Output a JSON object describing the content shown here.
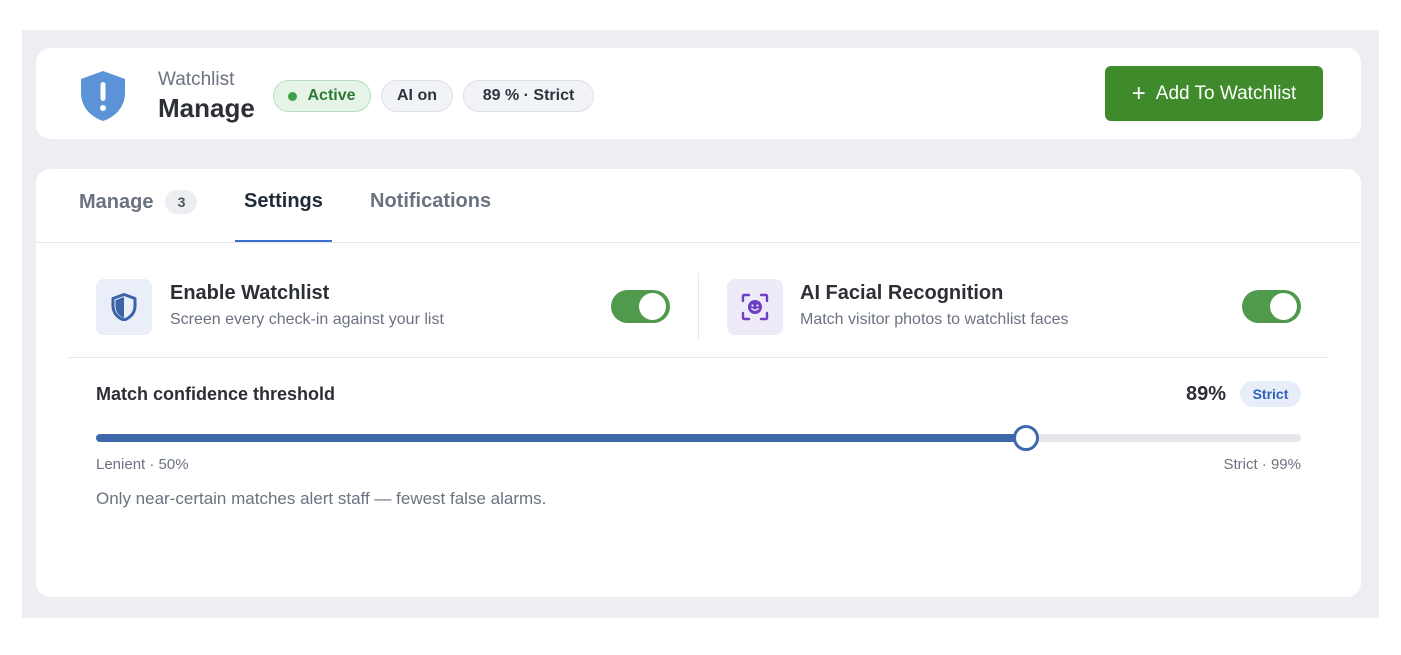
{
  "header": {
    "subtitle": "Watchlist",
    "title": "Manage",
    "status_badge": "Active",
    "ai_badge": "AI on",
    "threshold_badge_value": "89",
    "threshold_badge_suffix": " % · Strict",
    "add_button_label": "Add To Watchlist",
    "brand_color": "#3f8a2a"
  },
  "tabs": [
    {
      "label": "Manage",
      "count": "3",
      "selected": false
    },
    {
      "label": "Settings",
      "selected": true
    },
    {
      "label": "Notifications",
      "selected": false
    }
  ],
  "settings": {
    "features": [
      {
        "title": "Enable Watchlist",
        "description": "Screen every check-in against your list",
        "icon": "shield-icon",
        "enabled": true
      },
      {
        "title": "AI Facial Recognition",
        "description": "Match visitor photos to watchlist faces",
        "icon": "face-scan-icon",
        "enabled": true
      }
    ],
    "threshold": {
      "label": "Match confidence threshold",
      "value_text": "89%",
      "level_badge": "Strict",
      "value": 89,
      "min": 50,
      "max": 99,
      "min_label": "Lenient · 50%",
      "max_label": "Strict · 99%",
      "help_text": "Only near-certain matches alert staff — fewest false alarms."
    }
  }
}
